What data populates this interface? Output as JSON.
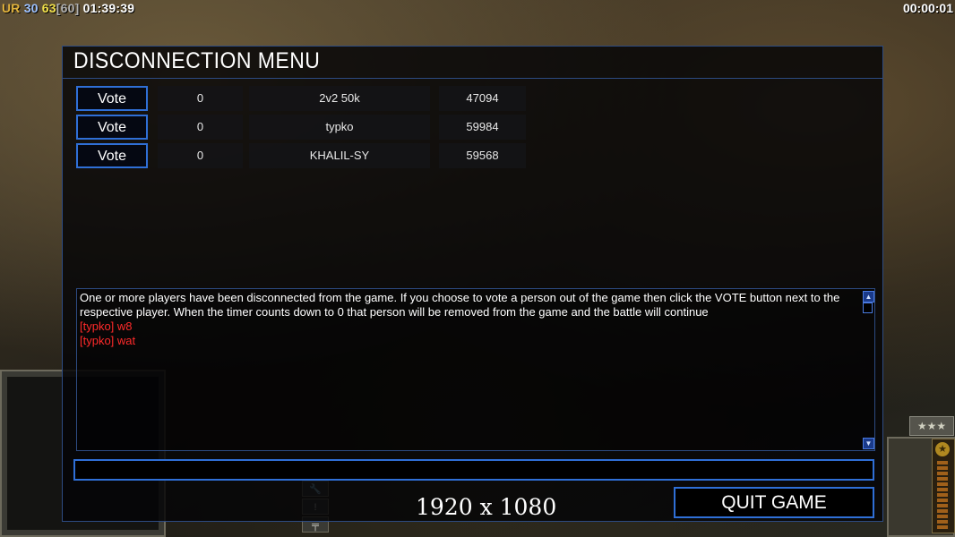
{
  "hud": {
    "faction": "UR",
    "stat_blue": "30",
    "stat_yellow": "63",
    "stat_cap": "[60]",
    "game_time": "01:39:39",
    "timer": "00:00:01"
  },
  "background_hud": {
    "rank_stars": "★★★",
    "tool_icons": [
      "wrench-icon",
      "alert-icon",
      "gun-icon"
    ]
  },
  "dialog": {
    "title": "DISCONNECTION MENU",
    "players": [
      {
        "vote_label": "Vote",
        "count": "0",
        "name": "2v2 50k",
        "ping": "47094"
      },
      {
        "vote_label": "Vote",
        "count": "0",
        "name": "typko",
        "ping": "59984"
      },
      {
        "vote_label": "Vote",
        "count": "0",
        "name": "KHALIL-SY",
        "ping": "59568"
      }
    ],
    "chat": {
      "system_message": "One or more players have been disconnected from the game. If you choose to vote a person out of the game then click the VOTE button next to the respective player. When the timer counts down to 0 that person will be removed from the game and the battle will continue",
      "messages": [
        "[typko] w8",
        "[typko] wat"
      ],
      "message_color": "#ff2a2a"
    },
    "chat_input": {
      "value": ""
    },
    "resolution": "1920 x 1080",
    "quit_label": "QUIT GAME"
  },
  "colors": {
    "accent_border": "#2f6fd6",
    "frame_border": "#2d4b82",
    "hud_faction": "#e2b33c",
    "hud_blue": "#9fc3ff",
    "hud_yellow": "#f1e04b"
  }
}
